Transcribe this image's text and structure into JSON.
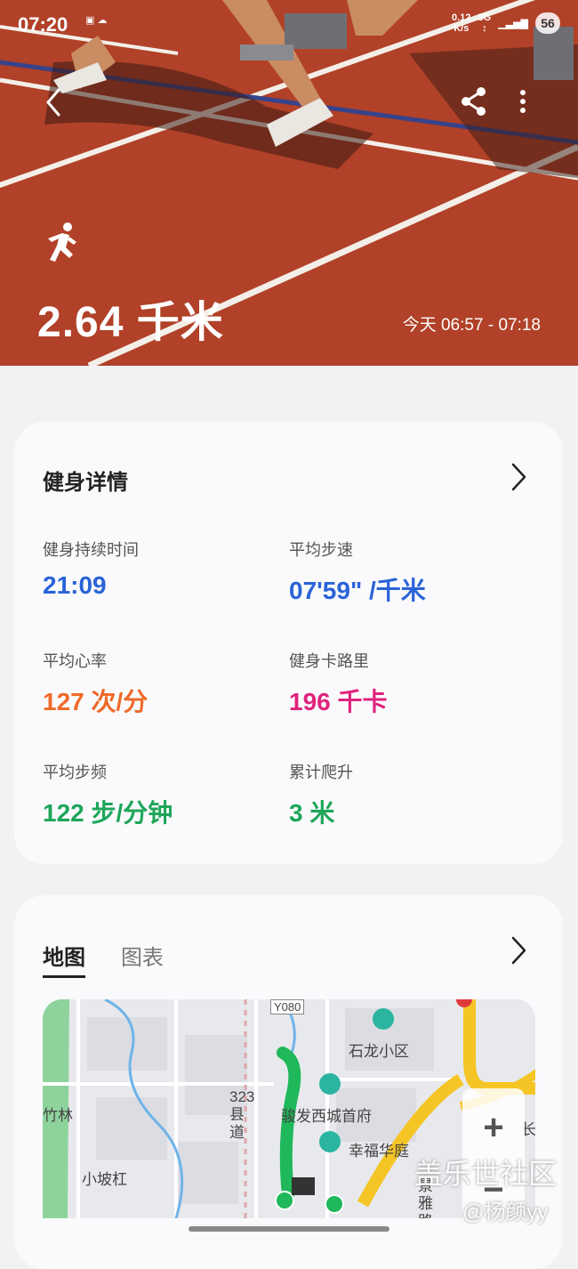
{
  "status_bar": {
    "time": "07:20",
    "network_speed": "0.12",
    "network_unit": "K/s",
    "signal": "5G",
    "battery": "56"
  },
  "header": {
    "distance": "2.64 千米",
    "time_range": "今天 06:57 - 07:18"
  },
  "details": {
    "title": "健身详情",
    "metrics": [
      {
        "label": "健身持续时间",
        "value": "21:09",
        "color": "#2a63d8"
      },
      {
        "label": "平均步速",
        "value": "07'59\" /千米",
        "color": "#2a63d8"
      },
      {
        "label": "平均心率",
        "value": "127 次/分",
        "color": "#ef6a2a"
      },
      {
        "label": "健身卡路里",
        "value": "196 千卡",
        "color": "#e0237d"
      },
      {
        "label": "平均步频",
        "value": "122 步/分钟",
        "color": "#1ea65a"
      },
      {
        "label": "累计爬升",
        "value": "3 米",
        "color": "#1ea65a"
      }
    ]
  },
  "map_card": {
    "tabs": [
      "地图",
      "图表"
    ],
    "map_labels": {
      "road_code": "Y080",
      "shilong": "石龙小区",
      "junfa": "骏发西城首府",
      "xingfu": "幸福华庭",
      "xiaopo": "小坡杠",
      "county_road": "323县道",
      "zhulin": "竹林",
      "jingya": "景雅路",
      "zhang": "长"
    },
    "zoom_plus": "+",
    "zoom_minus": "−"
  },
  "watermark": {
    "line1": "盖乐世社区",
    "line2": "@杨颜yy"
  },
  "colors": {
    "track_red": "#b8442a",
    "route_green": "#1fb85a",
    "road_yellow": "#f5c525"
  }
}
